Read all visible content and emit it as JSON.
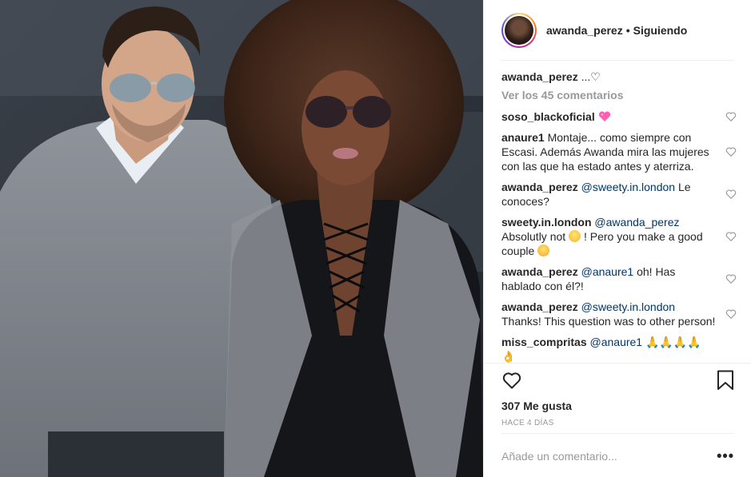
{
  "header": {
    "username": "awanda_perez",
    "separator": "•",
    "follow_status": "Siguiendo"
  },
  "caption": {
    "username": "awanda_perez",
    "text": "...♡"
  },
  "view_all_comments": "Ver los 45 comentarios",
  "comments": [
    {
      "user": "soso_blackoficial",
      "mention": "",
      "text": "",
      "emoji": "pink-heart-icon"
    },
    {
      "user": "anaure1",
      "mention": "",
      "text": "Montaje... como siempre con Escasi. Además Awanda mira las mujeres con las que ha estado antes y aterriza."
    },
    {
      "user": "awanda_perez",
      "mention": "@sweety.in.london",
      "text": "Le conoces?"
    },
    {
      "user": "sweety.in.london",
      "mention": "@awanda_perez",
      "text_a": "Absolutly not",
      "text_b": "! Pero you make a good couple"
    },
    {
      "user": "awanda_perez",
      "mention": "@anaure1",
      "text": "oh! Has hablado con él?!"
    },
    {
      "user": "awanda_perez",
      "mention": "@sweety.in.london",
      "text": "Thanks! This question was to other person!"
    },
    {
      "user": "miss_compritas",
      "mention": "@anaure1",
      "text": "🙏🙏🙏🙏 👌"
    }
  ],
  "likes": "307 Me gusta",
  "time_ago": "HACE 4 DÍAS",
  "add_comment": {
    "placeholder": "Añade un comentario...",
    "more": "•••"
  }
}
